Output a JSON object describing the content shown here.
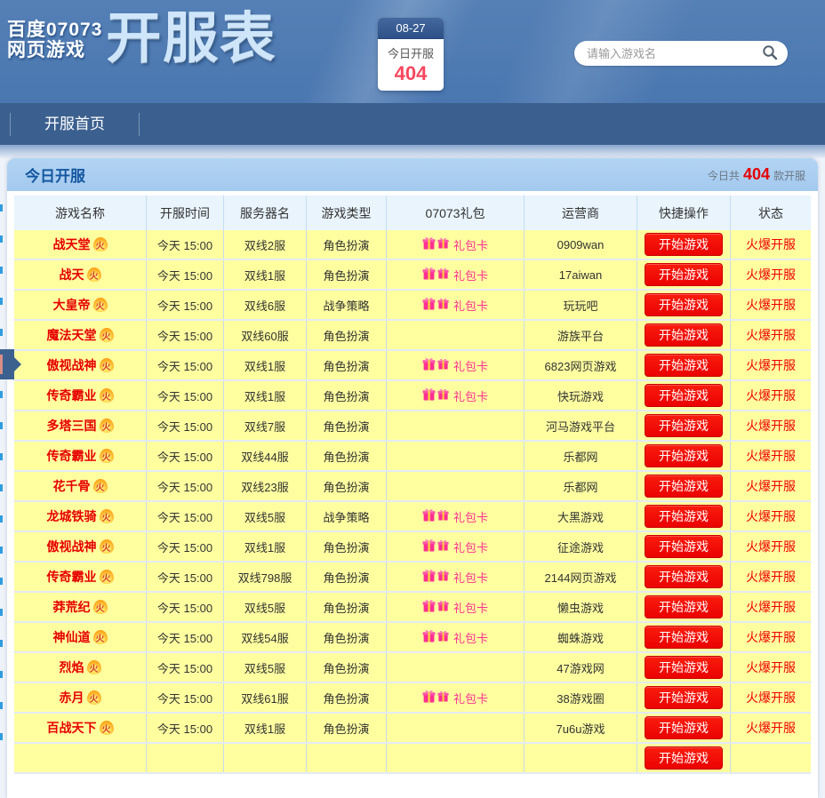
{
  "colors": {
    "accent_red": "#ee0000",
    "row_yellow": "#ffffa0",
    "gift_pink": "#ff3093",
    "panel_blue": "#a9cdf1",
    "nav_blue": "#3b608f",
    "header_blue": "#4a77b0",
    "badge_count_red": "#f8465f"
  },
  "header": {
    "logo_line1": "百度07073",
    "logo_line2": "网页游戏",
    "logo_main": "开服表",
    "date_badge": {
      "date": "08-27",
      "label": "今日开服",
      "count": "404"
    },
    "search": {
      "placeholder": "请输入游戏名"
    }
  },
  "nav": {
    "items": [
      {
        "label": "开服首页"
      }
    ]
  },
  "panel": {
    "title": "今日开服",
    "summary": {
      "prefix": "今日共",
      "count": "404",
      "suffix": "款开服"
    }
  },
  "table": {
    "columns": [
      "游戏名称",
      "开服时间",
      "服务器名",
      "游戏类型",
      "07073礼包",
      "运营商",
      "快捷操作",
      "状态"
    ],
    "fire_char": "火",
    "gift_label": "礼包卡",
    "start_label": "开始游戏",
    "status_label": "火爆开服",
    "partial_row_visible": true,
    "rows": [
      {
        "name": "战天堂",
        "time": "今天 15:00",
        "server": "双线2服",
        "type": "角色扮演",
        "gift": true,
        "operator": "0909wan"
      },
      {
        "name": "战天",
        "time": "今天 15:00",
        "server": "双线1服",
        "type": "角色扮演",
        "gift": true,
        "operator": "17aiwan"
      },
      {
        "name": "大皇帝",
        "time": "今天 15:00",
        "server": "双线6服",
        "type": "战争策略",
        "gift": true,
        "operator": "玩玩吧"
      },
      {
        "name": "魔法天堂",
        "time": "今天 15:00",
        "server": "双线60服",
        "type": "角色扮演",
        "gift": false,
        "operator": "游族平台"
      },
      {
        "name": "傲视战神",
        "time": "今天 15:00",
        "server": "双线1服",
        "type": "角色扮演",
        "gift": true,
        "operator": "6823网页游戏"
      },
      {
        "name": "传奇霸业",
        "time": "今天 15:00",
        "server": "双线1服",
        "type": "角色扮演",
        "gift": true,
        "operator": "快玩游戏"
      },
      {
        "name": "多塔三国",
        "time": "今天 15:00",
        "server": "双线7服",
        "type": "角色扮演",
        "gift": false,
        "operator": "河马游戏平台"
      },
      {
        "name": "传奇霸业",
        "time": "今天 15:00",
        "server": "双线44服",
        "type": "角色扮演",
        "gift": false,
        "operator": "乐都网"
      },
      {
        "name": "花千骨",
        "time": "今天 15:00",
        "server": "双线23服",
        "type": "角色扮演",
        "gift": false,
        "operator": "乐都网"
      },
      {
        "name": "龙城铁骑",
        "time": "今天 15:00",
        "server": "双线5服",
        "type": "战争策略",
        "gift": true,
        "operator": "大黑游戏"
      },
      {
        "name": "傲视战神",
        "time": "今天 15:00",
        "server": "双线1服",
        "type": "角色扮演",
        "gift": true,
        "operator": "征途游戏"
      },
      {
        "name": "传奇霸业",
        "time": "今天 15:00",
        "server": "双线798服",
        "type": "角色扮演",
        "gift": true,
        "operator": "2144网页游戏"
      },
      {
        "name": "莽荒纪",
        "time": "今天 15:00",
        "server": "双线5服",
        "type": "角色扮演",
        "gift": true,
        "operator": "懒虫游戏"
      },
      {
        "name": "神仙道",
        "time": "今天 15:00",
        "server": "双线54服",
        "type": "角色扮演",
        "gift": true,
        "operator": "蜘蛛游戏"
      },
      {
        "name": "烈焰",
        "time": "今天 15:00",
        "server": "双线5服",
        "type": "角色扮演",
        "gift": false,
        "operator": "47游戏网"
      },
      {
        "name": "赤月",
        "time": "今天 15:00",
        "server": "双线61服",
        "type": "角色扮演",
        "gift": true,
        "operator": "38游戏圈"
      },
      {
        "name": "百战天下",
        "time": "今天 15:00",
        "server": "双线1服",
        "type": "角色扮演",
        "gift": false,
        "operator": "7u6u游戏"
      }
    ]
  }
}
